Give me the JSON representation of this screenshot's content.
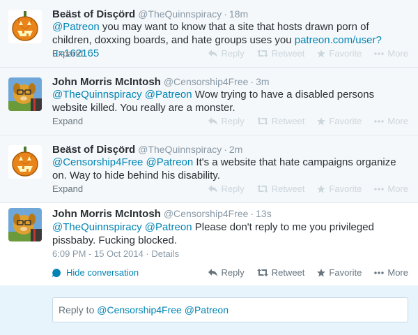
{
  "tweets": [
    {
      "fullname": "Beäst of Disçörd",
      "username": "@TheQuinnspiracy",
      "time": "18m",
      "text_parts": [
        "",
        "@Patreon",
        " you may want to know that a site that hosts drawn porn of children, doxxing boards, and hate groups uses you ",
        "patreon.com/user?u=162165",
        ""
      ],
      "expand": "Expand",
      "actions": {
        "reply": "Reply",
        "retweet": "Retweet",
        "favorite": "Favorite",
        "more": "More"
      }
    },
    {
      "fullname": "John Morris McIntosh",
      "username": "@Censorship4Free",
      "time": "3m",
      "text_parts": [
        "",
        "@TheQuinnspiracy",
        " ",
        "@Patreon",
        " Wow trying to have a disabled persons website killed. You really are a monster."
      ],
      "expand": "Expand",
      "actions": {
        "reply": "Reply",
        "retweet": "Retweet",
        "favorite": "Favorite",
        "more": "More"
      }
    },
    {
      "fullname": "Beäst of Disçörd",
      "username": "@TheQuinnspiracy",
      "time": "2m",
      "text_parts": [
        "",
        "@Censorship4Free",
        " ",
        "@Patreon",
        " It's a website that hate campaigns organize on. Way to hide behind his disability."
      ],
      "expand": "Expand",
      "actions": {
        "reply": "Reply",
        "retweet": "Retweet",
        "favorite": "Favorite",
        "more": "More"
      }
    },
    {
      "fullname": "John Morris McIntosh",
      "username": "@Censorship4Free",
      "time": "13s",
      "text_parts": [
        "",
        "@TheQuinnspiracy",
        " ",
        "@Patreon",
        " Please don't reply to me you privileged pissbaby. Fucking blocked."
      ],
      "timestamp": "6:09 PM - 15 Oct 2014",
      "details": "Details",
      "hide_conversation": "Hide conversation",
      "actions": {
        "reply": "Reply",
        "retweet": "Retweet",
        "favorite": "Favorite",
        "more": "More"
      }
    }
  ],
  "reply_box": {
    "prefix": "Reply to ",
    "mention1": "@Censorship4Free",
    "mention2": "@Patreon"
  },
  "icons": {
    "reply": "reply-icon",
    "retweet": "retweet-icon",
    "favorite": "star-icon",
    "more": "more-dots-icon",
    "conversation": "conversation-icon"
  },
  "colors": {
    "link": "#0084b4",
    "muted": "#8899a6",
    "action_inactive": "#ccd6dd",
    "action_active": "#66757f",
    "reply_bg": "#e8f4fb"
  }
}
